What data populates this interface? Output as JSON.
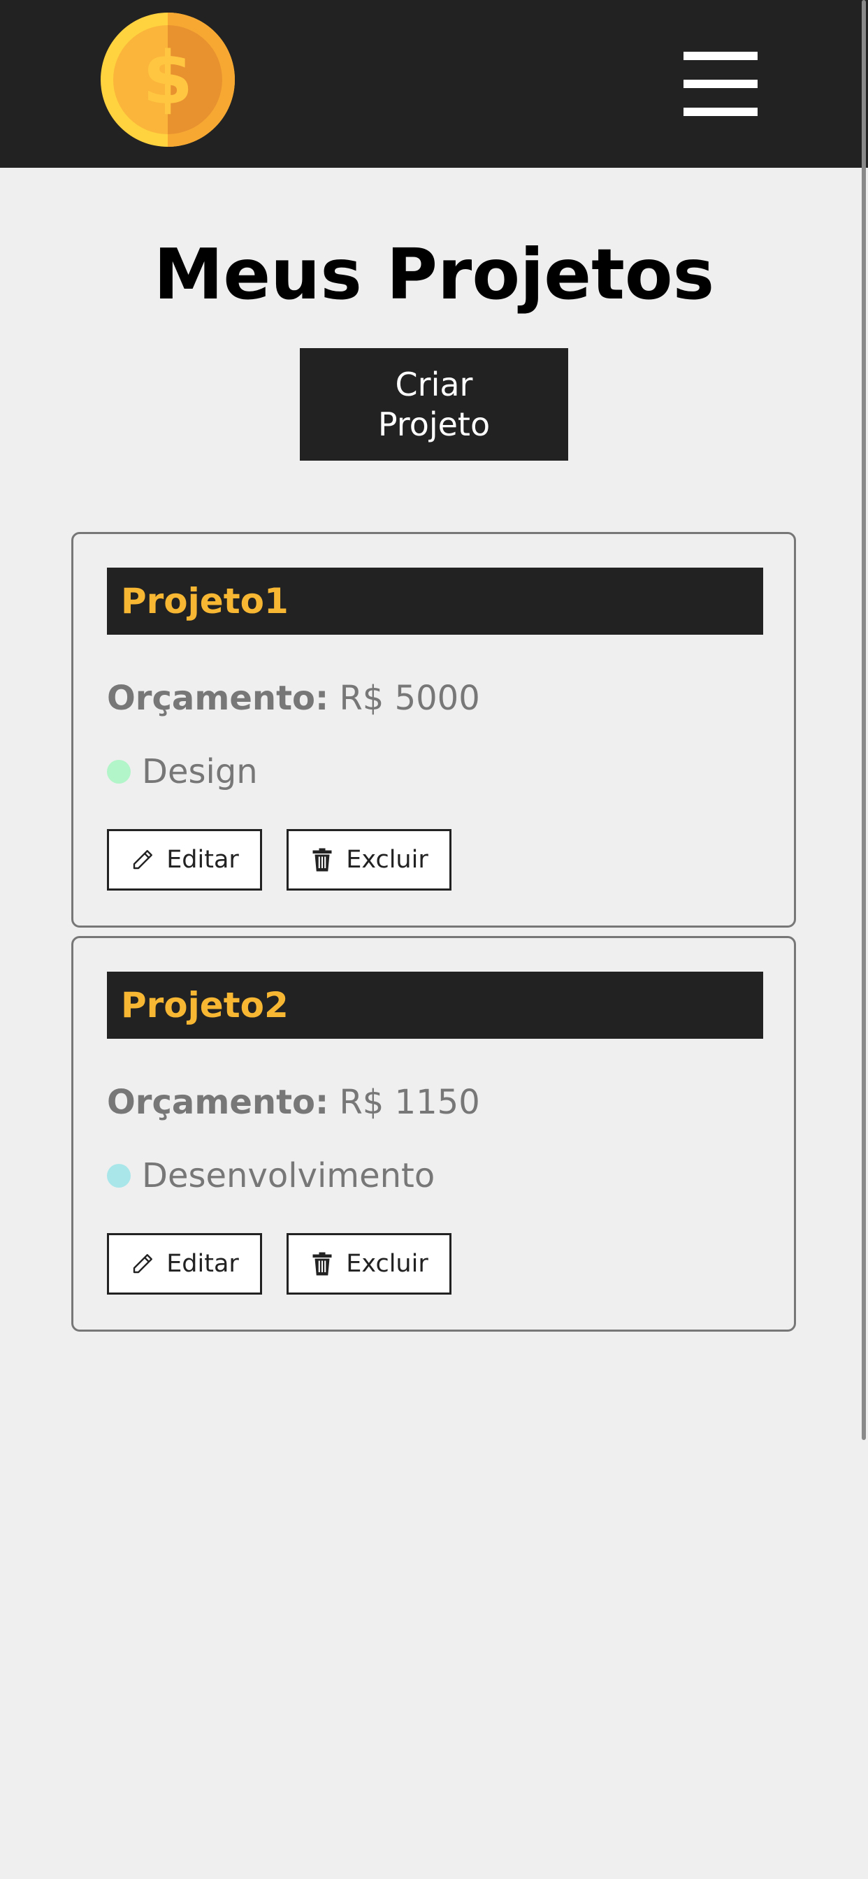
{
  "header": {
    "logo_icon": "dollar-coin-icon",
    "menu_icon": "hamburger-menu-icon"
  },
  "main": {
    "title": "Meus Projetos",
    "create_button_label": "Criar Projeto"
  },
  "projects": [
    {
      "name": "Projeto1",
      "budget_label": "Orçamento:",
      "budget_value": "R$ 5000",
      "category": "Design",
      "category_color": "#b2f5c8",
      "edit_label": "Editar",
      "delete_label": "Excluir"
    },
    {
      "name": "Projeto2",
      "budget_label": "Orçamento:",
      "budget_value": "R$ 1150",
      "category": "Desenvolvimento",
      "category_color": "#a8e6ea",
      "edit_label": "Editar",
      "delete_label": "Excluir"
    }
  ],
  "colors": {
    "navbar": "#222222",
    "background": "#efefef",
    "accent": "#f7b733",
    "muted_text": "#777777"
  }
}
